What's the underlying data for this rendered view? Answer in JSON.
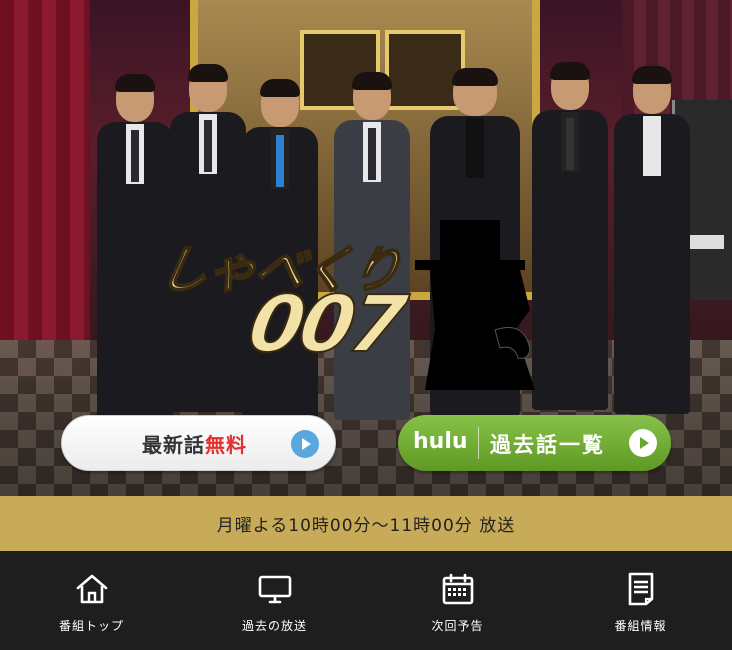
{
  "hero": {
    "image_alt": "Show cast photo on stage",
    "logo_line1": "しゃべくり",
    "logo_line2": "007",
    "free_button": {
      "label_main": "最新話",
      "label_accent": "無料"
    },
    "hulu_button": {
      "brand": "hulu",
      "label": "過去話一覧"
    },
    "colors": {
      "free_accent": "#e2302e",
      "hulu_green": "#6aa532",
      "play_blue": "#5aa7dd"
    }
  },
  "airtime": {
    "text": "月曜よる10時00分～11時00分 放送",
    "bg": "#c8ab58"
  },
  "nav": {
    "items": [
      {
        "label": "番組トップ",
        "icon": "home-icon"
      },
      {
        "label": "過去の放送",
        "icon": "monitor-icon"
      },
      {
        "label": "次回予告",
        "icon": "calendar-icon"
      },
      {
        "label": "番組情報",
        "icon": "document-icon"
      }
    ]
  }
}
